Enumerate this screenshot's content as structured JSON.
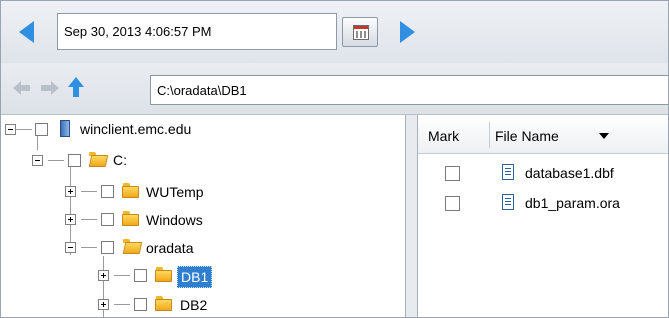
{
  "date_navigator": {
    "value": "Sep 30, 2013 4:06:57 PM",
    "prev_icon": "blue-left-arrow",
    "next_icon": "blue-right-arrow",
    "calendar_icon": "calendar-icon"
  },
  "path_bar": {
    "back_icon": "back-arrow-disabled",
    "forward_icon": "forward-arrow-disabled",
    "up_icon": "up-arrow-blue",
    "path": "C:\\oradata\\DB1"
  },
  "tree": {
    "nodes": [
      {
        "label": "winclient.emc.edu",
        "icon": "computer-icon",
        "expanded": true
      },
      {
        "label": "C:",
        "icon": "folder-open-icon",
        "expanded": true
      },
      {
        "label": "WUTemp",
        "icon": "folder-icon",
        "expanded": false
      },
      {
        "label": "Windows",
        "icon": "folder-icon",
        "expanded": false
      },
      {
        "label": "oradata",
        "icon": "folder-open-icon",
        "expanded": true
      },
      {
        "label": "DB1",
        "icon": "folder-icon",
        "expanded": false,
        "selected": true
      },
      {
        "label": "DB2",
        "icon": "folder-icon",
        "expanded": false
      }
    ]
  },
  "file_list": {
    "columns": {
      "mark": "Mark",
      "name": "File Name"
    },
    "sort_icon": "sort-descending-icon",
    "files": [
      {
        "name": "database1.dbf",
        "icon": "document-icon"
      },
      {
        "name": "db1_param.ora",
        "icon": "document-icon"
      }
    ]
  },
  "colors": {
    "accent": "#2f8fe0",
    "selection": "#2f7fd0",
    "folder": "#f2b72c"
  }
}
